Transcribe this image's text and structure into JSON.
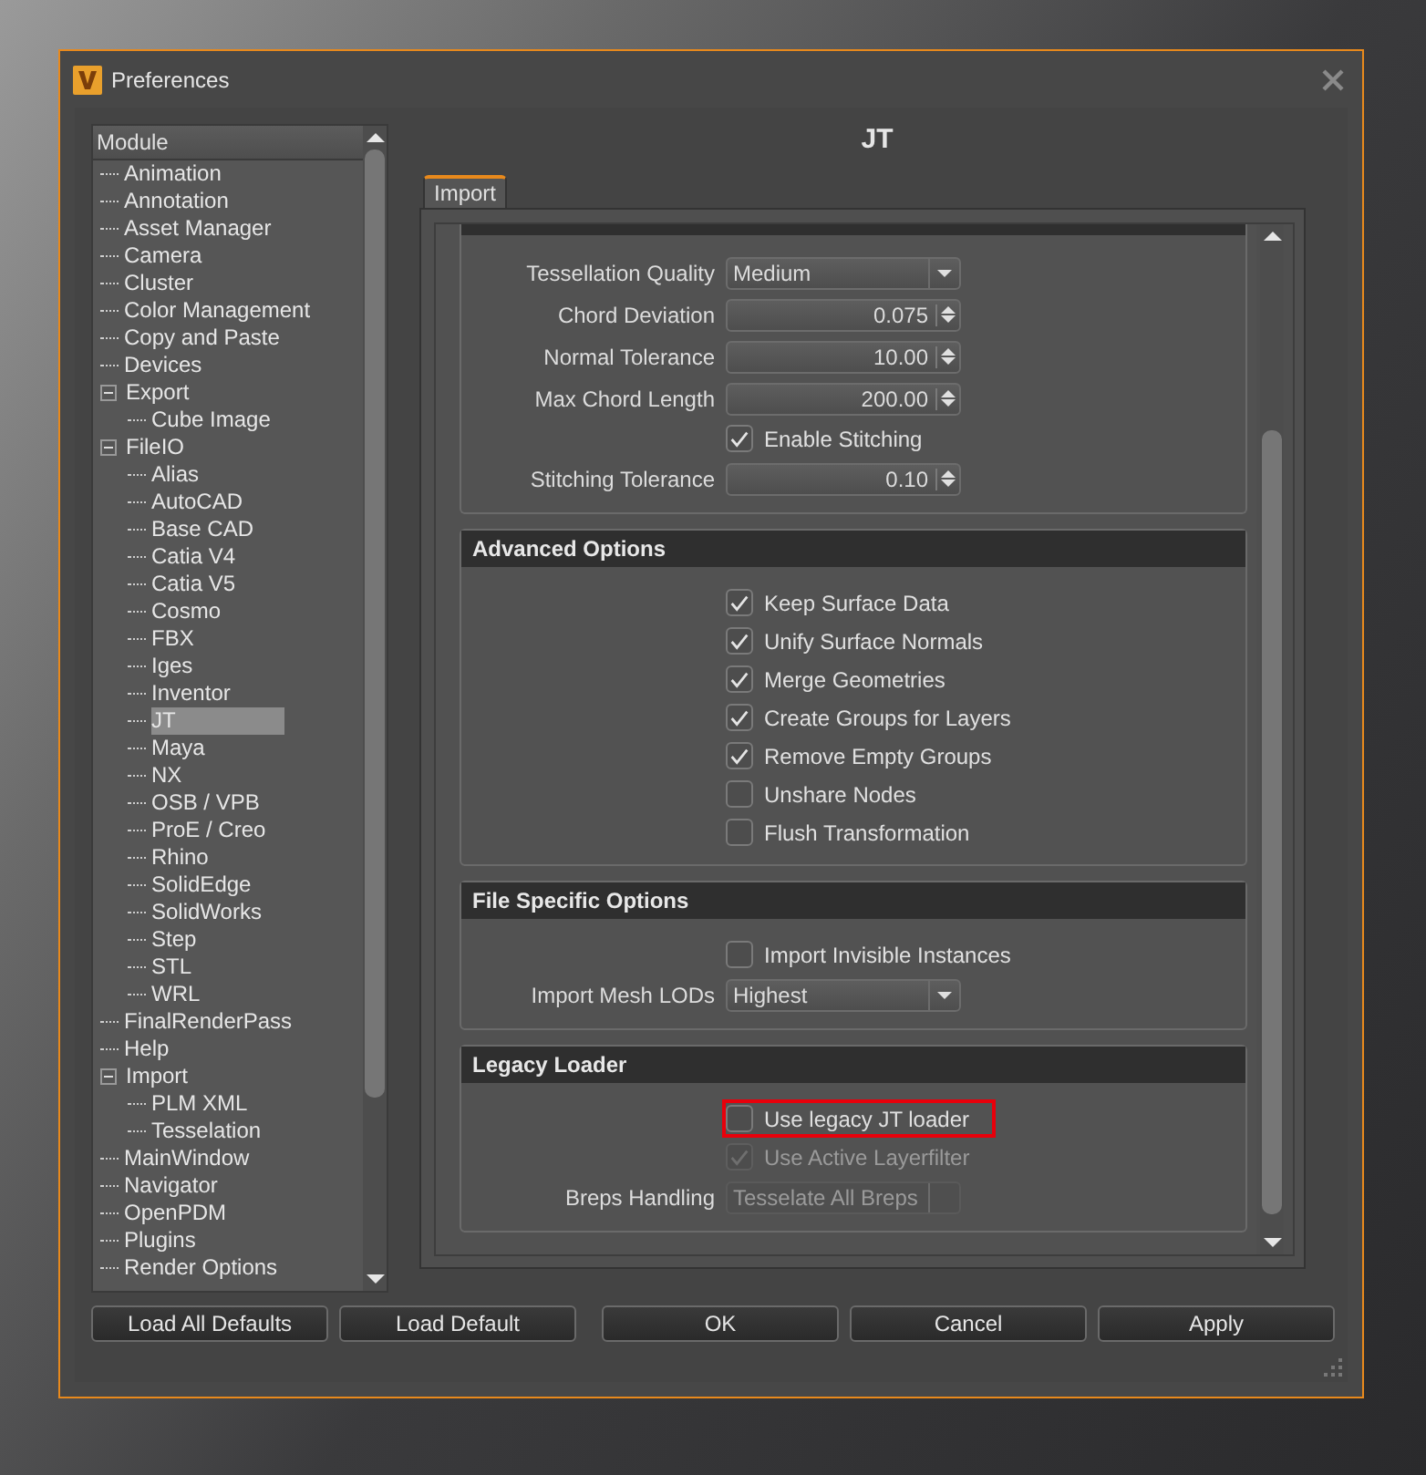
{
  "window": {
    "title": "Preferences"
  },
  "tree": {
    "header": "Module",
    "items": [
      {
        "label": "Animation",
        "selected": false
      },
      {
        "label": "Annotation",
        "selected": false
      },
      {
        "label": "Asset Manager",
        "selected": false
      },
      {
        "label": "Camera",
        "selected": false
      },
      {
        "label": "Cluster",
        "selected": false
      },
      {
        "label": "Color Management",
        "selected": false
      },
      {
        "label": "Copy and Paste",
        "selected": false
      },
      {
        "label": "Devices",
        "selected": false
      },
      {
        "label": "Export",
        "selected": false,
        "expanded": true,
        "children": [
          {
            "label": "Cube Image",
            "selected": false
          }
        ]
      },
      {
        "label": "FileIO",
        "selected": false,
        "expanded": true,
        "children": [
          {
            "label": "Alias",
            "selected": false
          },
          {
            "label": "AutoCAD",
            "selected": false
          },
          {
            "label": "Base CAD",
            "selected": false
          },
          {
            "label": "Catia V4",
            "selected": false
          },
          {
            "label": "Catia V5",
            "selected": false
          },
          {
            "label": "Cosmo",
            "selected": false
          },
          {
            "label": "FBX",
            "selected": false
          },
          {
            "label": "Iges",
            "selected": false
          },
          {
            "label": "Inventor",
            "selected": false
          },
          {
            "label": "JT",
            "selected": true
          },
          {
            "label": "Maya",
            "selected": false
          },
          {
            "label": "NX",
            "selected": false
          },
          {
            "label": "OSB / VPB",
            "selected": false
          },
          {
            "label": "ProE / Creo",
            "selected": false
          },
          {
            "label": "Rhino",
            "selected": false
          },
          {
            "label": "SolidEdge",
            "selected": false
          },
          {
            "label": "SolidWorks",
            "selected": false
          },
          {
            "label": "Step",
            "selected": false
          },
          {
            "label": "STL",
            "selected": false
          },
          {
            "label": "WRL",
            "selected": false
          }
        ]
      },
      {
        "label": "FinalRenderPass",
        "selected": false
      },
      {
        "label": "Help",
        "selected": false
      },
      {
        "label": "Import",
        "selected": false,
        "expanded": true,
        "children": [
          {
            "label": "PLM XML",
            "selected": false
          },
          {
            "label": "Tesselation",
            "selected": false
          }
        ]
      },
      {
        "label": "MainWindow",
        "selected": false
      },
      {
        "label": "Navigator",
        "selected": false
      },
      {
        "label": "OpenPDM",
        "selected": false
      },
      {
        "label": "Plugins",
        "selected": false
      },
      {
        "label": "Render Options",
        "selected": false
      }
    ]
  },
  "page_title": "JT",
  "tabs": [
    {
      "label": "Import",
      "selected": true
    }
  ],
  "groups": [
    {
      "rows": [
        {
          "kind": "combo",
          "label": "Tessellation Quality",
          "value": "Medium",
          "disabled": false
        },
        {
          "kind": "spin",
          "label": "Chord Deviation",
          "value": "0.075"
        },
        {
          "kind": "spin",
          "label": "Normal Tolerance",
          "value": "10.00"
        },
        {
          "kind": "spin",
          "label": "Max Chord Length",
          "value": "200.00"
        },
        {
          "kind": "check",
          "label": "Enable Stitching",
          "checked": true,
          "disabled": false,
          "highlighted": false
        },
        {
          "kind": "spin",
          "label": "Stitching Tolerance",
          "value": "0.10"
        }
      ]
    },
    {
      "title": "Advanced Options",
      "rows": [
        {
          "kind": "check",
          "label": "Keep Surface Data",
          "checked": true,
          "disabled": false,
          "highlighted": false
        },
        {
          "kind": "check",
          "label": "Unify Surface Normals",
          "checked": true,
          "disabled": false,
          "highlighted": false
        },
        {
          "kind": "check",
          "label": "Merge Geometries",
          "checked": true,
          "disabled": false,
          "highlighted": false
        },
        {
          "kind": "check",
          "label": "Create Groups for Layers",
          "checked": true,
          "disabled": false,
          "highlighted": false
        },
        {
          "kind": "check",
          "label": "Remove Empty Groups",
          "checked": true,
          "disabled": false,
          "highlighted": false
        },
        {
          "kind": "check",
          "label": "Unshare Nodes",
          "checked": false,
          "disabled": false,
          "highlighted": false
        },
        {
          "kind": "check",
          "label": "Flush Transformation",
          "checked": false,
          "disabled": false,
          "highlighted": false
        }
      ]
    },
    {
      "title": "File Specific Options",
      "rows": [
        {
          "kind": "check",
          "label": "Import Invisible Instances",
          "checked": false,
          "disabled": false,
          "highlighted": false
        },
        {
          "kind": "combo",
          "label": "Import Mesh LODs",
          "value": "Highest",
          "disabled": false
        }
      ]
    },
    {
      "title": "Legacy Loader",
      "rows": [
        {
          "kind": "check",
          "label": "Use legacy JT loader",
          "checked": false,
          "disabled": false,
          "highlighted": true
        },
        {
          "kind": "check",
          "label": "Use Active Layerfilter",
          "checked": true,
          "disabled": true,
          "highlighted": false
        },
        {
          "kind": "combo",
          "label": "Breps Handling",
          "value": "Tesselate All Breps",
          "disabled": true
        }
      ]
    }
  ],
  "buttons": [
    "Load All Defaults",
    "Load Default",
    "OK",
    "Cancel",
    "Apply"
  ]
}
